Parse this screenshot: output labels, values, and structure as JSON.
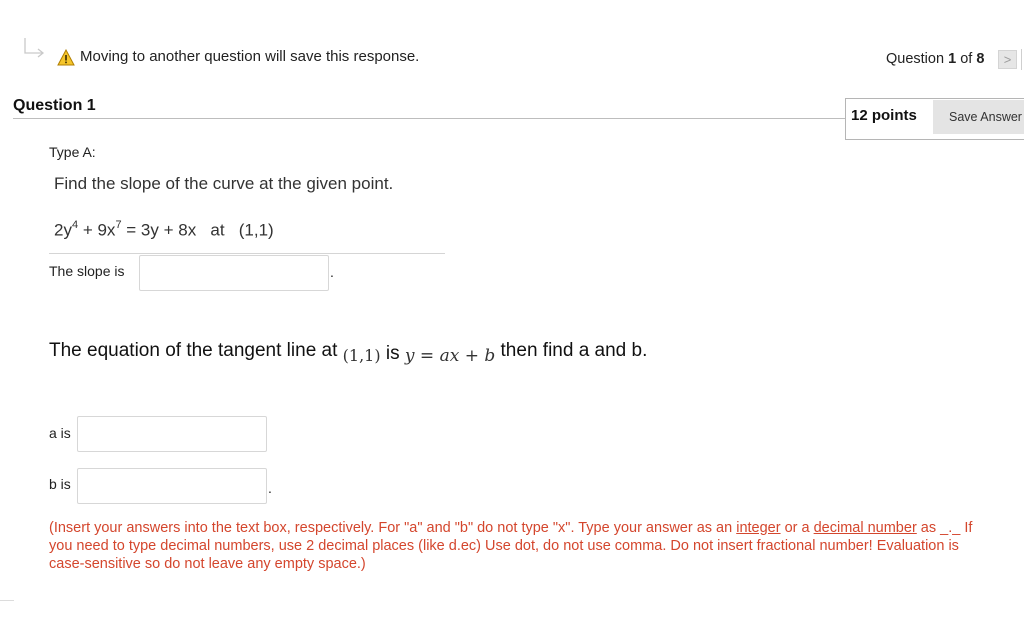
{
  "topbar": {
    "warning_text": "Moving to another question will save this response.",
    "question_prefix": "Question",
    "question_current": "1",
    "question_of": "of",
    "question_total": "8",
    "next_glyph": ">"
  },
  "question": {
    "title": "Question 1",
    "points": "12 points",
    "save_label": "Save Answer",
    "type_label": "Type A:",
    "prompt": "Find the slope of the curve at the given point.",
    "equation": {
      "part1": "2y",
      "exp1": "4",
      "part2": " + 9x",
      "exp2": "7",
      "part3": " = 3y + 8x   at   (1,1)"
    },
    "slope_label": "The slope is",
    "slope_value": "",
    "slope_suffix": ".",
    "tangent": {
      "prefix": "The equation of the tangent line at ",
      "point": "(1,1)",
      "is": " is ",
      "lhs": "y",
      "eq": " = ",
      "a": "a",
      "x": "x",
      "plus": " + ",
      "b": "b",
      "suffix": " then find a and b."
    },
    "a_label": "a is",
    "a_value": "",
    "b_label": "b is",
    "b_value": "",
    "b_suffix": ".",
    "instructions": {
      "part1": "(Insert your answers into the text box, respectively. For \"a\" and \"b\" do not type \"x\". Type your answer as an ",
      "link1": "integer",
      "part2": " or a ",
      "link2": "decimal number",
      "part3": " as _._ If you need to type decimal numbers, use 2 decimal places (like d.ec) Use dot, do not use comma. Do not insert fractional number! Evaluation is case-sensitive so do not leave any empty space.)"
    }
  },
  "colors": {
    "warning_yellow": "#f5c52a",
    "instruction_red": "#d4462d",
    "save_button_bg": "#e4e4e4"
  }
}
